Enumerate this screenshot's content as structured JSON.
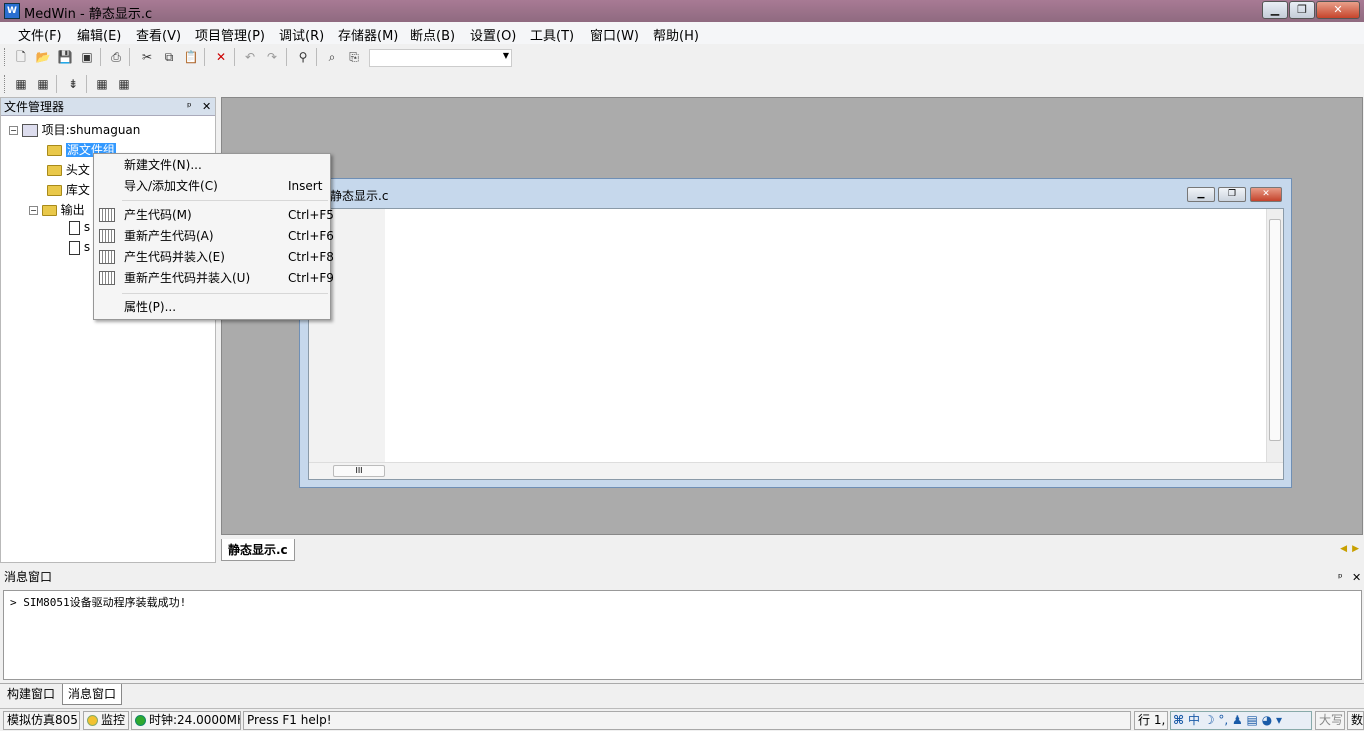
{
  "window": {
    "title": "MedWin - 静态显示.c",
    "icon": "medwin-app-icon"
  },
  "menubar": [
    "文件(F)",
    "编辑(E)",
    "查看(V)",
    "项目管理(P)",
    "调试(R)",
    "存储器(M)",
    "断点(B)",
    "设置(O)",
    "工具(T)",
    "窗口(W)",
    "帮助(H)"
  ],
  "file_manager": {
    "title": "文件管理器",
    "project": "项目:shumaguan",
    "folders": [
      "源文件组",
      "头文",
      "库文",
      "输出"
    ],
    "files": [
      "s",
      "s"
    ]
  },
  "editor": {
    "child_title": "静态显示.c",
    "tab_label": "静态显示.c",
    "hscroll_grip": "III"
  },
  "context_menu": {
    "items": [
      {
        "label": "新建文件(N)...",
        "shortcut": ""
      },
      {
        "label": "导入/添加文件(C)",
        "shortcut": "Insert"
      },
      {
        "label": "产生代码(M)",
        "shortcut": "Ctrl+F5"
      },
      {
        "label": "重新产生代码(A)",
        "shortcut": "Ctrl+F6"
      },
      {
        "label": "产生代码并装入(E)",
        "shortcut": "Ctrl+F8"
      },
      {
        "label": "重新产生代码并装入(U)",
        "shortcut": "Ctrl+F9"
      },
      {
        "label": "属性(P)...",
        "shortcut": ""
      }
    ]
  },
  "message_window": {
    "title": "消息窗口",
    "lines": [
      "SIM8051设备驱动程序装载成功!"
    ]
  },
  "bottom_tabs": [
    "构建窗口",
    "消息窗口"
  ],
  "statusbar": {
    "mode": "模拟仿真805:",
    "monitor": "监控",
    "clock": "时钟:24.0000MH",
    "help": "Press F1 help!",
    "line": "行 1,",
    "ime": "中 ☽ °, ♟ ▤ ◕ ▾",
    "caps": "大写",
    "num": "数字",
    "monitor_color": "#f2c230",
    "clock_color": "#2fa82f"
  },
  "colors": {
    "title_bar": "#9a7088",
    "selection": "#3399ff",
    "mdi_background": "#ababab"
  }
}
